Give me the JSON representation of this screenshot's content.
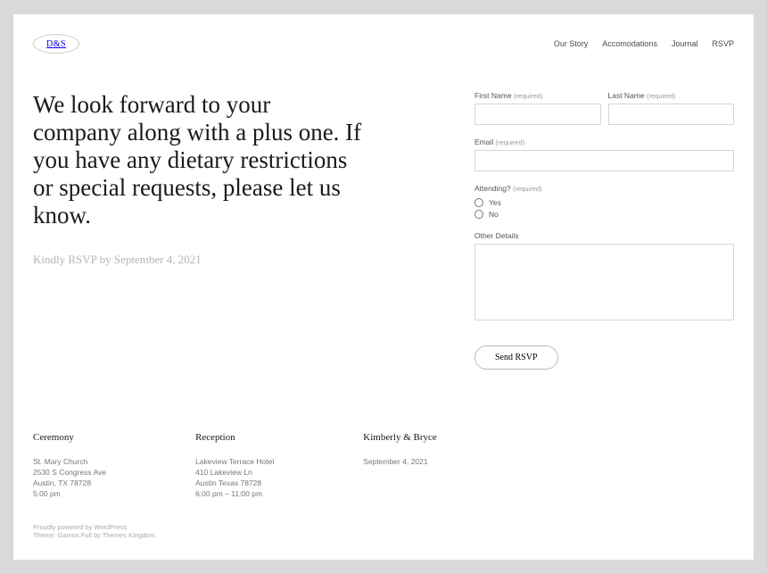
{
  "logo": "D&S",
  "nav": [
    "Our Story",
    "Accomodations",
    "Journal",
    "RSVP"
  ],
  "intro": {
    "headline": "We look forward to your company along with a plus one. If you have any dietary restrictions or special requests, please let us know.",
    "subhead": "Kindly RSVP by September 4, 2021"
  },
  "form": {
    "first_name_label": "First Name",
    "last_name_label": "Last Name",
    "email_label": "Email",
    "attending_label": "Attending?",
    "other_label": "Other Details",
    "required": "(required)",
    "yes": "Yes",
    "no": "No",
    "submit": "Send RSVP"
  },
  "footer": {
    "ceremony": {
      "title": "Ceremony",
      "lines": [
        "St. Mary Church",
        "2530 S Congress Ave",
        "Austin, TX 78728",
        "5:00 pm"
      ]
    },
    "reception": {
      "title": "Reception",
      "lines": [
        "Lakeview Terrace Hotel",
        "410 Lakeview Ln",
        "Austin Texas 78728",
        "6:00 pm – 11:00 pm"
      ]
    },
    "couple": {
      "title": "Kimberly & Bryce",
      "lines": [
        "September 4, 2021"
      ]
    }
  },
  "credits": {
    "line1_a": "Proudly powered by ",
    "line1_b": "WordPress",
    "line2_a": "Theme: ",
    "line2_b": "Gamos Full",
    "line2_c": " by ",
    "line2_d": "Themes Kingdom",
    "line2_e": "."
  }
}
